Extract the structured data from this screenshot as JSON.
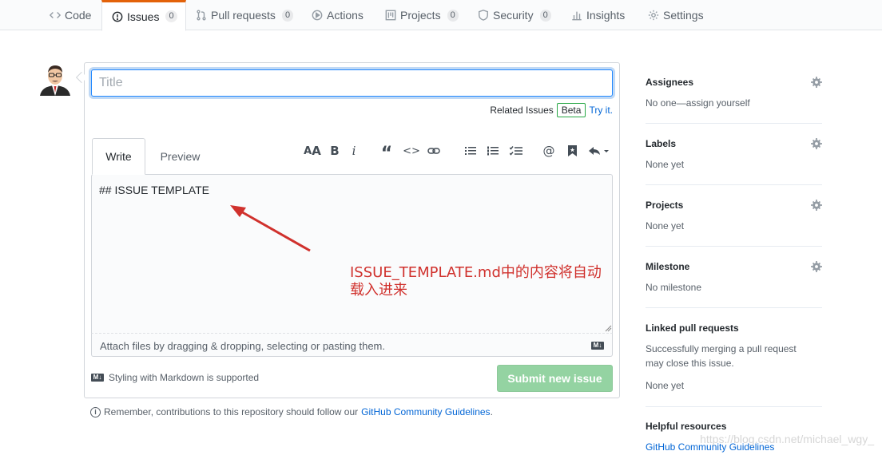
{
  "nav": {
    "tabs": [
      {
        "label": "Code",
        "count": null,
        "icon": "code-icon"
      },
      {
        "label": "Issues",
        "count": "0",
        "icon": "issue-opened-icon"
      },
      {
        "label": "Pull requests",
        "count": "0",
        "icon": "git-pull-request-icon"
      },
      {
        "label": "Actions",
        "count": null,
        "icon": "play-icon"
      },
      {
        "label": "Projects",
        "count": "0",
        "icon": "project-icon"
      },
      {
        "label": "Security",
        "count": "0",
        "icon": "shield-icon"
      },
      {
        "label": "Insights",
        "count": null,
        "icon": "graph-icon"
      },
      {
        "label": "Settings",
        "count": null,
        "icon": "gear-icon"
      }
    ],
    "selected": "Issues"
  },
  "form": {
    "title_placeholder": "Title",
    "related_label": "Related Issues",
    "beta_label": "Beta",
    "try_it": "Try it.",
    "tab_write": "Write",
    "tab_preview": "Preview",
    "body_text": "## ISSUE TEMPLATE",
    "attach_hint": "Attach files by dragging & dropping, selecting or pasting them.",
    "markdown_note": "Styling with Markdown is supported",
    "submit_label": "Submit new issue",
    "guidelines_prefix": "Remember, contributions to this repository should follow our",
    "guidelines_link": "GitHub Community Guidelines",
    "guidelines_suffix": "."
  },
  "toolbar": [
    "header-icon",
    "bold-icon",
    "italic-icon",
    "quote-icon",
    "code-icon",
    "link-icon",
    "unordered-list-icon",
    "ordered-list-icon",
    "task-list-icon",
    "mention-icon",
    "saved-reply-icon",
    "reply-icon"
  ],
  "annotation": {
    "line1": "ISSUE_TEMPLATE.md中的内容将自动",
    "line2": "载入进来",
    "color": "#d0312d"
  },
  "sidebar": {
    "assignees": {
      "heading": "Assignees",
      "text": "No one—assign yourself"
    },
    "labels": {
      "heading": "Labels",
      "text": "None yet"
    },
    "projects": {
      "heading": "Projects",
      "text": "None yet"
    },
    "milestone": {
      "heading": "Milestone",
      "text": "No milestone"
    },
    "linked": {
      "heading": "Linked pull requests",
      "text1": "Successfully merging a pull request may close this issue.",
      "text2": "None yet"
    },
    "helpful": {
      "heading": "Helpful resources",
      "link": "GitHub Community Guidelines"
    }
  },
  "watermark": "https://blog.csdn.net/michael_wgy_",
  "colors": {
    "accent": "#0366d6",
    "submit_disabled": "#94d3a2",
    "tab_border_top": "#e36209"
  }
}
